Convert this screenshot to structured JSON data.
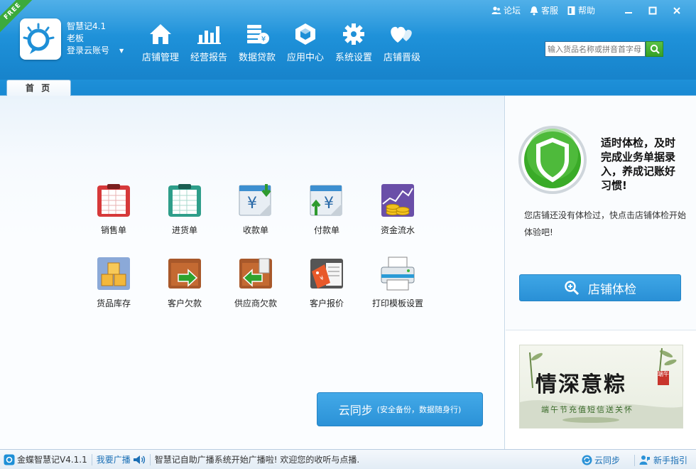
{
  "app": {
    "badge": "FREE",
    "name": "智慧记4.1",
    "user": "老板",
    "account_link": "登录云账号"
  },
  "topbar": {
    "forum": "论坛",
    "support": "客服",
    "help": "帮助"
  },
  "nav": [
    {
      "label": "店铺管理",
      "icon": "store-icon"
    },
    {
      "label": "经营报告",
      "icon": "bar-chart-icon"
    },
    {
      "label": "数据贷款",
      "icon": "loan-icon"
    },
    {
      "label": "应用中心",
      "icon": "app-center-icon"
    },
    {
      "label": "系统设置",
      "icon": "gear-icon"
    },
    {
      "label": "店铺晋级",
      "icon": "upgrade-hearts-icon"
    }
  ],
  "search": {
    "placeholder": "输入货品名称或拼音首字母"
  },
  "tabs": [
    {
      "label": "首 页",
      "active": true
    }
  ],
  "tiles": [
    {
      "label": "销售单",
      "icon": "sales-order-icon"
    },
    {
      "label": "进货单",
      "icon": "purchase-order-icon"
    },
    {
      "label": "收款单",
      "icon": "receipt-icon"
    },
    {
      "label": "付款单",
      "icon": "payment-icon"
    },
    {
      "label": "资金流水",
      "icon": "cash-flow-icon"
    },
    {
      "label": "货品库存",
      "icon": "inventory-icon"
    },
    {
      "label": "客户欠款",
      "icon": "customer-debt-icon"
    },
    {
      "label": "供应商欠款",
      "icon": "supplier-debt-icon"
    },
    {
      "label": "客户报价",
      "icon": "customer-quote-icon"
    },
    {
      "label": "打印模板设置",
      "icon": "printer-icon"
    }
  ],
  "sync": {
    "label": "云同步",
    "sub": "(安全备份，数据随身行)"
  },
  "side": {
    "title": "适时体检，及时完成业务单据录入，养成记账好习惯!",
    "body": "您店铺还没有体检过，快点击店铺体检开始体验吧!",
    "check_button": "店铺体检",
    "banner": {
      "line1": "情深意粽",
      "line2": "端午节充值短信送关怀",
      "seal": "端午"
    }
  },
  "status": {
    "app_version": "金蝶智慧记V4.1.1",
    "broadcast_link": "我要广播",
    "message": "智慧记自助广播系统开始广播啦! 欢迎您的收听与点播.",
    "cloud_sync": "云同步",
    "guide": "新手指引"
  },
  "colors": {
    "header": "#1d8fd7",
    "accent_green": "#36a025",
    "button_blue": "#2b92d7"
  }
}
